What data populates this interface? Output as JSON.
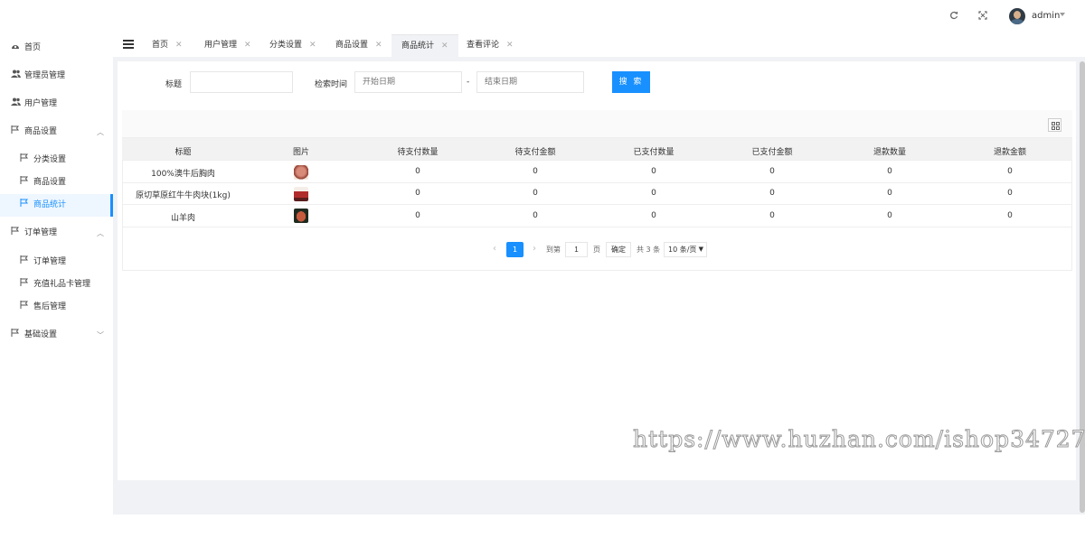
{
  "header": {
    "refresh_icon": "refresh-icon",
    "fullscreen_icon": "fullscreen-icon",
    "user_name": "admin"
  },
  "sidebar": {
    "items": [
      {
        "label": "首页",
        "icon": "dashboard-icon"
      },
      {
        "label": "管理员管理",
        "icon": "users-icon"
      },
      {
        "label": "用户管理",
        "icon": "users-icon"
      },
      {
        "label": "商品设置",
        "icon": "flag-icon",
        "expanded": true
      },
      {
        "label": "分类设置",
        "icon": "flag-icon"
      },
      {
        "label": "商品设置",
        "icon": "flag-icon"
      },
      {
        "label": "商品统计",
        "icon": "flag-icon",
        "active": true
      },
      {
        "label": "订单管理",
        "icon": "flag-icon",
        "expanded": true
      },
      {
        "label": "订单管理",
        "icon": "flag-icon"
      },
      {
        "label": "充值礼品卡管理",
        "icon": "flag-icon"
      },
      {
        "label": "售后管理",
        "icon": "flag-icon"
      },
      {
        "label": "基础设置",
        "icon": "flag-icon",
        "expanded": false
      }
    ]
  },
  "tabs": [
    {
      "label": "首页"
    },
    {
      "label": "用户管理"
    },
    {
      "label": "分类设置"
    },
    {
      "label": "商品设置"
    },
    {
      "label": "商品统计",
      "active": true
    },
    {
      "label": "查看评论"
    }
  ],
  "search": {
    "title_label": "标题",
    "title_value": "",
    "time_label": "检索时间",
    "start_placeholder": "开始日期",
    "end_placeholder": "结束日期",
    "separator": "-",
    "button_label": "搜 索"
  },
  "table": {
    "columns": [
      "标题",
      "图片",
      "待支付数量",
      "待支付金额",
      "已支付数量",
      "已支付金额",
      "退款数量",
      "退款金额"
    ],
    "rows": [
      {
        "title": "100%澳牛后胸肉",
        "image": "beef-brisket-thumbnail",
        "values": [
          "0",
          "0",
          "0",
          "0",
          "0",
          "0"
        ]
      },
      {
        "title": "原切草原红牛牛肉块(1kg)",
        "image": "beef-chunks-thumbnail",
        "values": [
          "0",
          "0",
          "0",
          "0",
          "0",
          "0"
        ]
      },
      {
        "title": "山羊肉",
        "image": "goat-meat-thumbnail",
        "values": [
          "0",
          "0",
          "0",
          "0",
          "0",
          "0"
        ]
      }
    ]
  },
  "pagination": {
    "current_page": "1",
    "goto_label": "到第",
    "goto_value": "1",
    "page_suffix": "页",
    "confirm_label": "确定",
    "total_label": "共 3 条",
    "page_size": "10 条/页"
  },
  "watermark": "https://www.huzhan.com/ishop34727",
  "colors": {
    "accent": "#1890ff",
    "background": "#f0f2f5"
  }
}
